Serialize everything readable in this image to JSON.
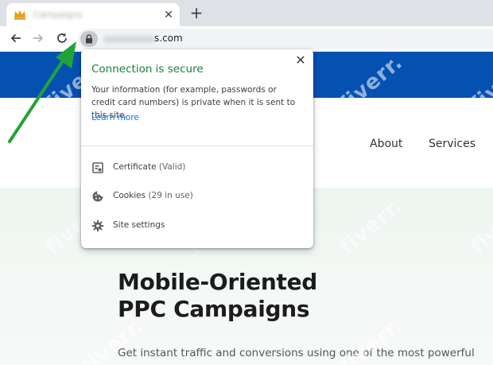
{
  "browser": {
    "tab": {
      "title": "Campaigns",
      "close_glyph": "✕",
      "favicon": "crown-icon"
    },
    "new_tab_glyph": "+",
    "toolbar": {
      "back_icon": "back-arrow-icon",
      "forward_icon": "forward-arrow-icon",
      "reload_icon": "reload-icon",
      "url_visible": "s.com"
    }
  },
  "site": {
    "nav": {
      "about": "About",
      "services": "Services"
    },
    "hero": {
      "title_line1": "Mobile-Oriented",
      "title_line2": "PPC Campaigns",
      "subtitle": "Get instant traffic and conversions using one of the most powerful"
    }
  },
  "popup": {
    "close_glyph": "✕",
    "heading": "Connection is secure",
    "body": "Your information (for example, passwords or credit card numbers) is private when it is sent to this site.",
    "learn_more": "Learn more",
    "rows": [
      {
        "icon": "certificate-icon",
        "label": "Certificate",
        "detail": "(Valid)"
      },
      {
        "icon": "cookie-icon",
        "label": "Cookies",
        "detail": "(29 in use)"
      },
      {
        "icon": "gear-icon",
        "label": "Site settings",
        "detail": ""
      }
    ]
  },
  "watermark": {
    "text": "fiverr."
  },
  "colors": {
    "site_banner": "#0551b2",
    "secure_green": "#188038",
    "link_blue": "#1a73e8",
    "annotation_arrow": "#22a33a"
  }
}
